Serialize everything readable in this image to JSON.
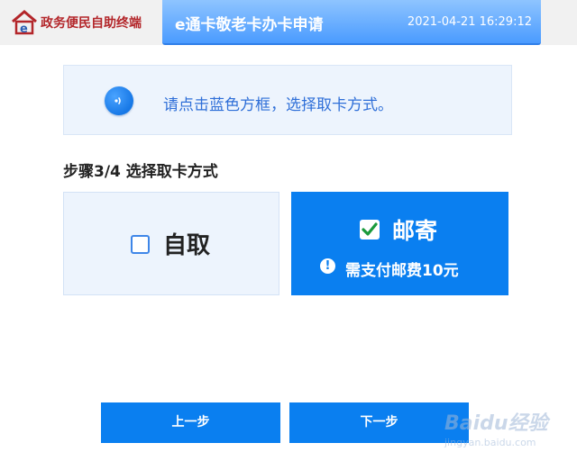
{
  "header": {
    "logo_text": "政务便民自助终端",
    "title": "e通卡敬老卡办卡申请",
    "datetime": "2021-04-21 16:29:12"
  },
  "notice": {
    "icon": "speaker-icon",
    "text": "请点击蓝色方框，选择取卡方式。"
  },
  "step": {
    "title": "步骤3/4 选择取卡方式"
  },
  "options": [
    {
      "label": "自取",
      "checked": false
    },
    {
      "label": "邮寄",
      "checked": true,
      "note": "需支付邮费10元"
    }
  ],
  "buttons": {
    "prev": "上一步",
    "next": "下一步"
  },
  "watermark": {
    "main": "Baidu经验",
    "sub": "jingyan.baidu.com"
  },
  "colors": {
    "accent": "#0a7ff0",
    "notice_text": "#2f6fd8",
    "logo_red": "#b3262a"
  }
}
